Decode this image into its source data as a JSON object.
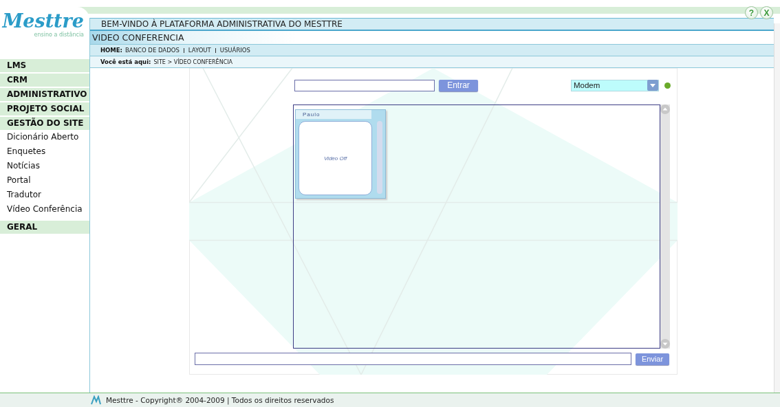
{
  "logo": {
    "name": "Mesttre",
    "tagline": "ensino a distância"
  },
  "header": {
    "welcome": "BEM-VINDO À PLATAFORMA ADMINISTRATIVA DO MESTTRE",
    "section_title": "VIDEO CONFERENCIA",
    "help_button": "?",
    "close_button": "X",
    "nav": {
      "label": "HOME:",
      "links": [
        "BANCO DE DADOS",
        "LAYOUT",
        "USUÁRIOS"
      ]
    },
    "breadcrumb": {
      "label": "Você está aqui:",
      "path": "SITE > VÍDEO CONFERÊNCIA"
    }
  },
  "sidebar": {
    "items": [
      {
        "kind": "category",
        "label": "LMS"
      },
      {
        "kind": "category",
        "label": "CRM"
      },
      {
        "kind": "category",
        "label": "ADMINISTRATIVO"
      },
      {
        "kind": "category",
        "label": "PROJETO SOCIAL"
      },
      {
        "kind": "category",
        "label": "GESTÃO DO SITE"
      },
      {
        "kind": "link",
        "label": "Dicionário Aberto"
      },
      {
        "kind": "link",
        "label": "Enquetes"
      },
      {
        "kind": "link",
        "label": "Notícias"
      },
      {
        "kind": "link",
        "label": "Portal"
      },
      {
        "kind": "link",
        "label": "Tradutor"
      },
      {
        "kind": "link",
        "label": "Vídeo Conferência"
      },
      {
        "kind": "category",
        "label": "GERAL"
      }
    ]
  },
  "conference": {
    "enter_button": "Entrar",
    "connection": "Modem",
    "online": true,
    "participants": [
      {
        "name": "Paulo",
        "video": "Video Off"
      }
    ],
    "send_button": "Enviar"
  },
  "footer": {
    "text": "Mesttre - Copyright® 2004-2009 | Todos os direitos reservados"
  }
}
